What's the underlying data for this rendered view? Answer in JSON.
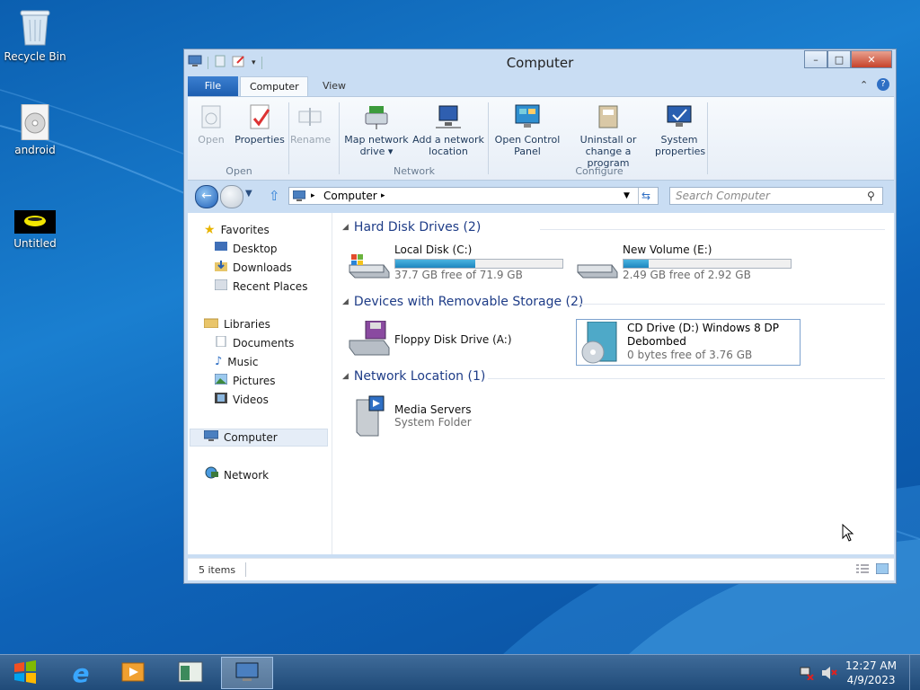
{
  "desktop": {
    "icons": [
      {
        "label": "Recycle Bin",
        "icon": "recycle-bin-icon"
      },
      {
        "label": "android",
        "icon": "disc-image-icon"
      },
      {
        "label": "Untitled",
        "icon": "app-icon"
      }
    ]
  },
  "window": {
    "title": "Computer",
    "controls": {
      "minimize": "–",
      "maximize": "□",
      "close": "✕"
    },
    "tabs": [
      {
        "label": "File",
        "active": false
      },
      {
        "label": "Computer",
        "active": true
      },
      {
        "label": "View",
        "active": false
      }
    ],
    "ribbon": {
      "groups": [
        {
          "name": "Open",
          "buttons": [
            {
              "label": "Open"
            },
            {
              "label": "Properties"
            },
            {
              "label": "Rename"
            }
          ]
        },
        {
          "name": "Network",
          "buttons": [
            {
              "label": "Map network drive ▾"
            },
            {
              "label": "Add a network location"
            }
          ]
        },
        {
          "name": "Configure",
          "buttons": [
            {
              "label": "Open Control Panel"
            },
            {
              "label": "Uninstall or change a program"
            },
            {
              "label": "System properties"
            }
          ]
        }
      ],
      "btn_labels": {
        "open_l1": "Open",
        "properties_l1": "Properties",
        "rename_l1": "Rename",
        "map_l1": "Map network",
        "map_l2": "drive ▾",
        "addnet_l1": "Add a network",
        "addnet_l2": "location",
        "cp_l1": "Open Control",
        "cp_l2": "Panel",
        "uninst_l1": "Uninstall or",
        "uninst_l2": "change a program",
        "sys_l1": "System",
        "sys_l2": "properties"
      }
    },
    "address": {
      "path": "Computer",
      "separator": "▸"
    },
    "search": {
      "placeholder": "Search Computer"
    },
    "navpane": {
      "favorites": {
        "label": "Favorites",
        "items": [
          "Desktop",
          "Downloads",
          "Recent Places"
        ]
      },
      "libraries": {
        "label": "Libraries",
        "items": [
          "Documents",
          "Music",
          "Pictures",
          "Videos"
        ]
      },
      "computer": "Computer",
      "network": "Network"
    },
    "groups": {
      "hdd": {
        "header": "Hard Disk Drives (2)",
        "drives": [
          {
            "name": "Local Disk (C:)",
            "free": "37.7 GB free of 71.9 GB",
            "used_fraction": 0.48
          },
          {
            "name": "New Volume (E:)",
            "free": "2.49 GB free of 2.92 GB",
            "used_fraction": 0.15
          }
        ]
      },
      "removable": {
        "header": "Devices with Removable Storage (2)",
        "floppy": {
          "name": "Floppy Disk Drive (A:)"
        },
        "cd": {
          "name_line1": "CD Drive (D:) Windows 8 DP",
          "name_line2": "Debombed",
          "free": "0 bytes free of 3.76 GB"
        }
      },
      "network": {
        "header": "Network Location (1)",
        "item": {
          "name": "Media Servers",
          "type": "System Folder"
        }
      }
    },
    "status": {
      "items": "5 items"
    }
  },
  "taskbar": {
    "clock_time": "12:27 AM",
    "clock_date": "4/9/2023"
  }
}
